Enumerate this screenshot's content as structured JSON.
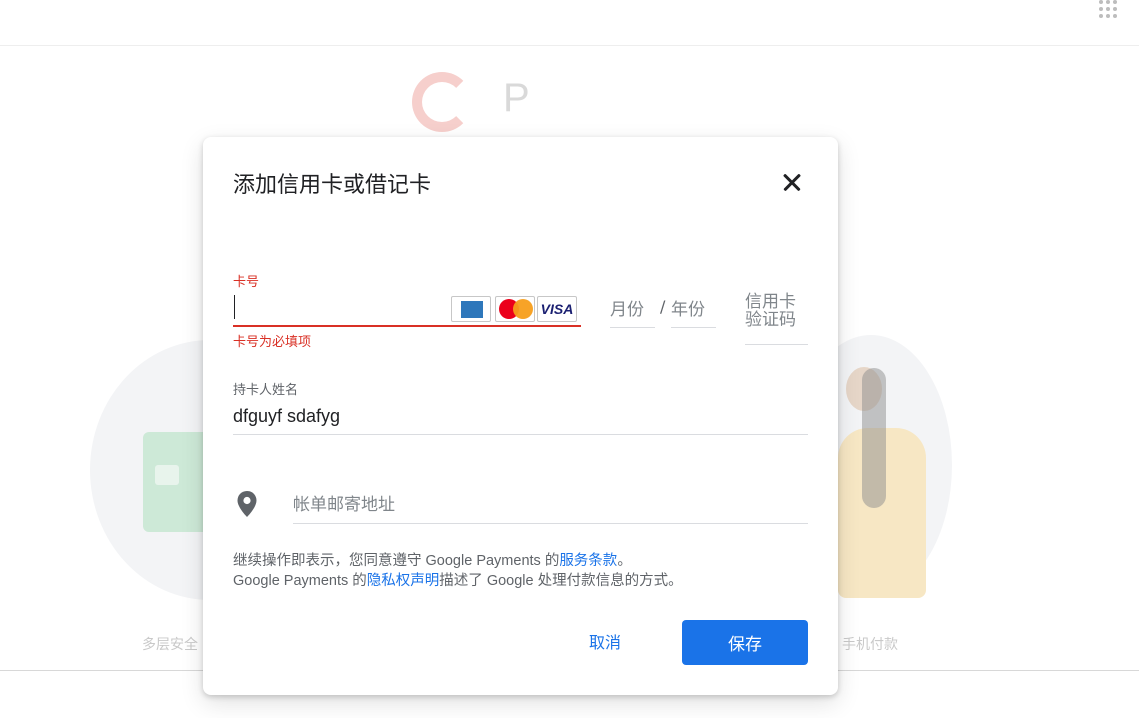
{
  "background": {
    "logo_letter_p": "P",
    "caption_left": "多层安全",
    "caption_right": "手机付款"
  },
  "dialog": {
    "title": "添加信用卡或借记卡",
    "card_number": {
      "label": "卡号",
      "value": "",
      "error": "卡号为必填项",
      "brands": [
        "American Express",
        "MasterCard",
        "VISA"
      ],
      "visa_text": "VISA"
    },
    "expiry": {
      "month_placeholder": "月份",
      "separator": "/",
      "year_placeholder": "年份"
    },
    "cvc": {
      "placeholder": "信用卡验证码"
    },
    "cardholder": {
      "label": "持卡人姓名",
      "value": "dfguyf sdafyg"
    },
    "billing_address": {
      "placeholder": "帐单邮寄地址"
    },
    "terms": {
      "line1_prefix": "继续操作即表示，您同意遵守 Google Payments 的",
      "tos_link": "服务条款",
      "line1_suffix": "。",
      "line2_prefix": "Google Payments 的",
      "privacy_link": "隐私权声明",
      "line2_suffix": "描述了 Google 处理付款信息的方式。"
    },
    "cancel_label": "取消",
    "save_label": "保存"
  },
  "colors": {
    "error": "#d93025",
    "primary": "#1a73e8"
  }
}
